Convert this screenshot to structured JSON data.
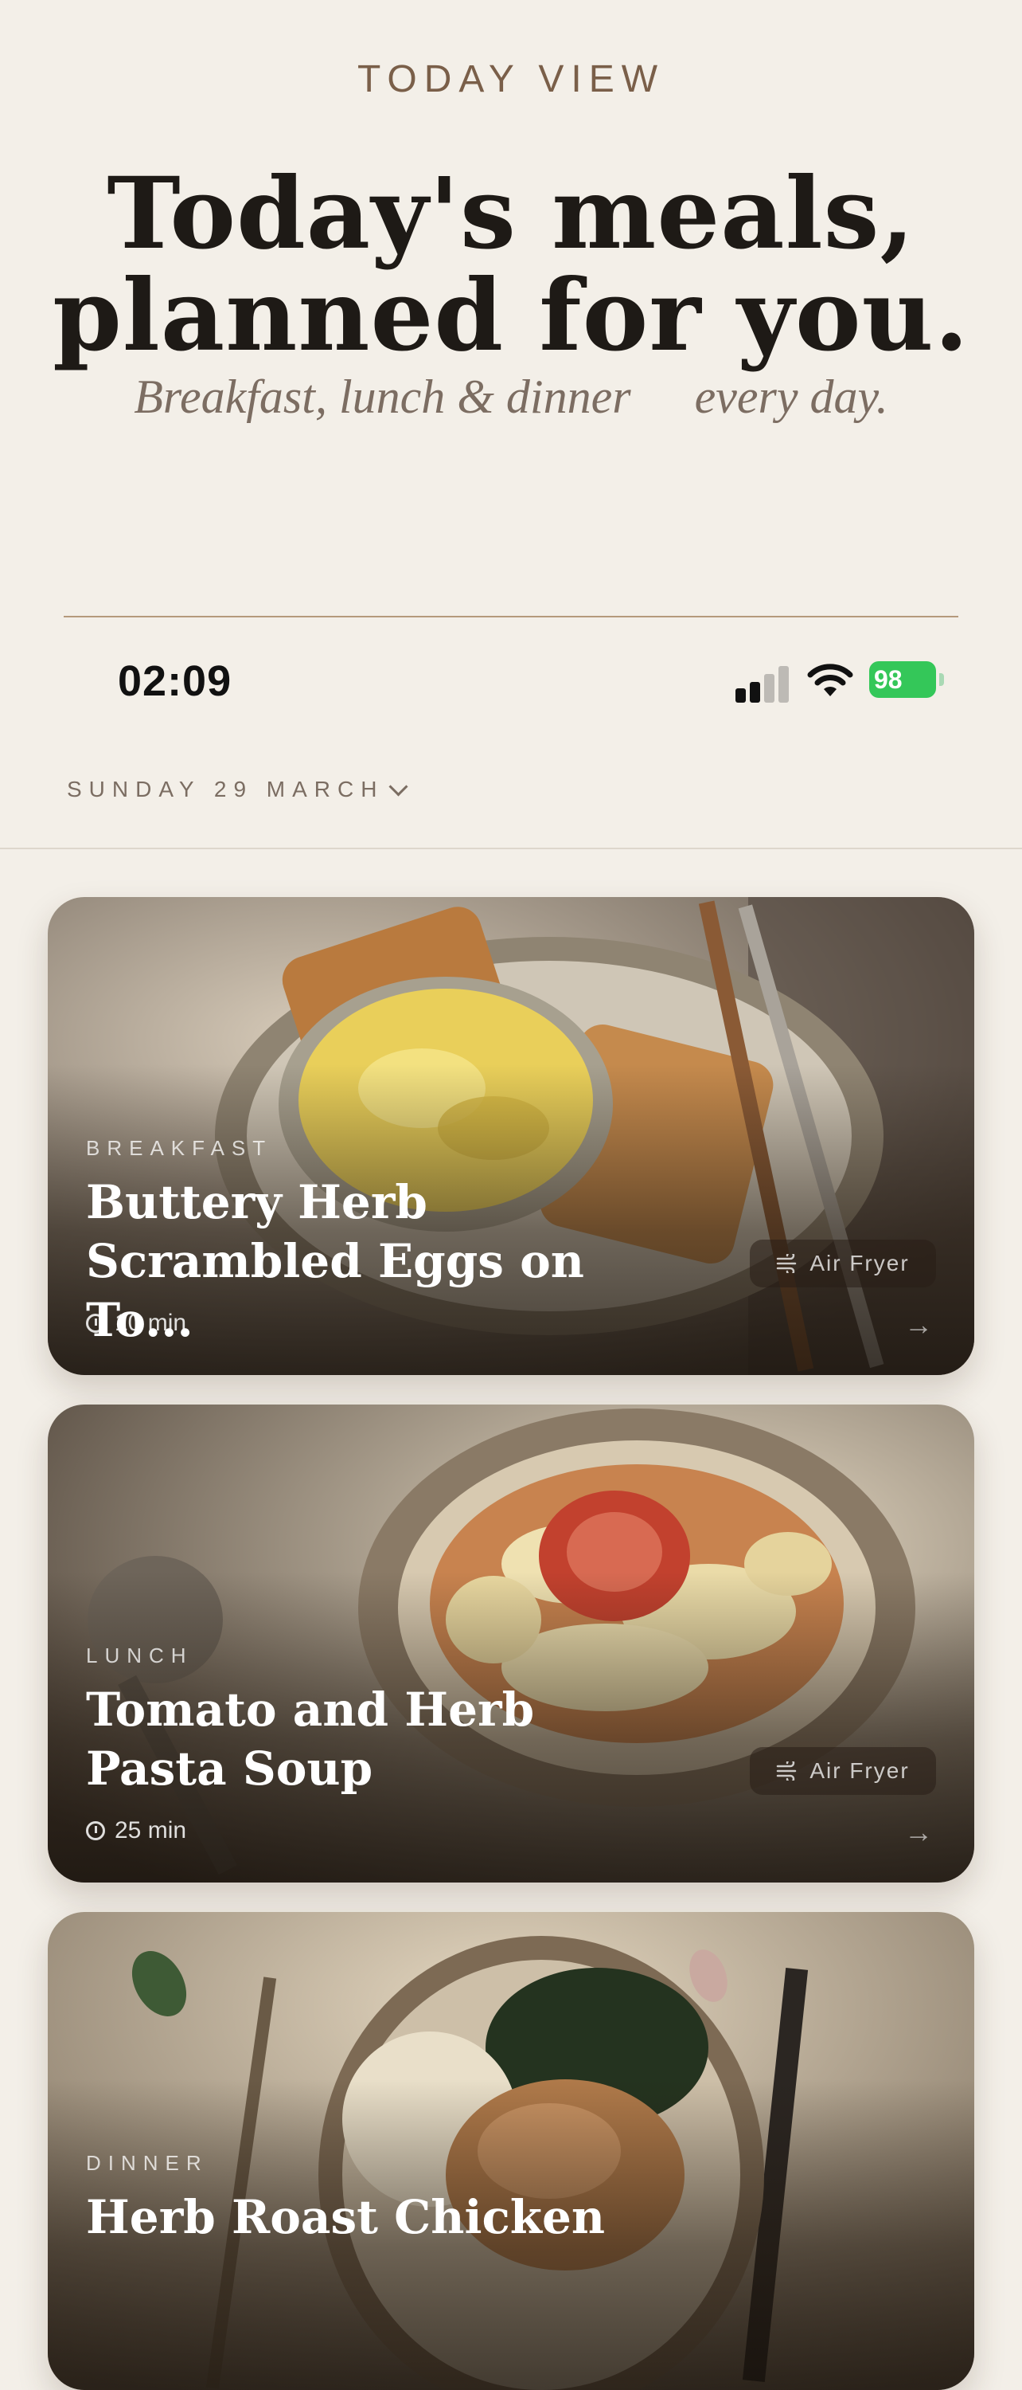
{
  "hero": {
    "eyebrow": "TODAY VIEW",
    "headline_line1": "Today's meals,",
    "headline_line2": "planned for you.",
    "subline_left": "Breakfast, lunch & dinner",
    "subline_right": "every day."
  },
  "status_bar": {
    "time": "02:09",
    "battery": "98",
    "battery_color": "#34c759"
  },
  "date_selector": {
    "label": "SUNDAY 29 MARCH"
  },
  "meals": [
    {
      "label": "BREAKFAST",
      "title_line1": "Buttery Herb",
      "title_line2": "Scrambled Eggs on To...",
      "duration": "10 min",
      "appliance": "Air Fryer"
    },
    {
      "label": "LUNCH",
      "title_line1": "Tomato and Herb",
      "title_line2": "Pasta Soup",
      "duration": "25 min",
      "appliance": "Air Fryer"
    },
    {
      "label": "DINNER",
      "title_line1": "Herb Roast Chicken",
      "title_line2": ""
    }
  ],
  "icons": [
    "signal-icon",
    "wifi-icon",
    "battery-icon",
    "chevron-down-icon",
    "clock-icon",
    "air-fryer-icon",
    "arrow-right-icon"
  ]
}
